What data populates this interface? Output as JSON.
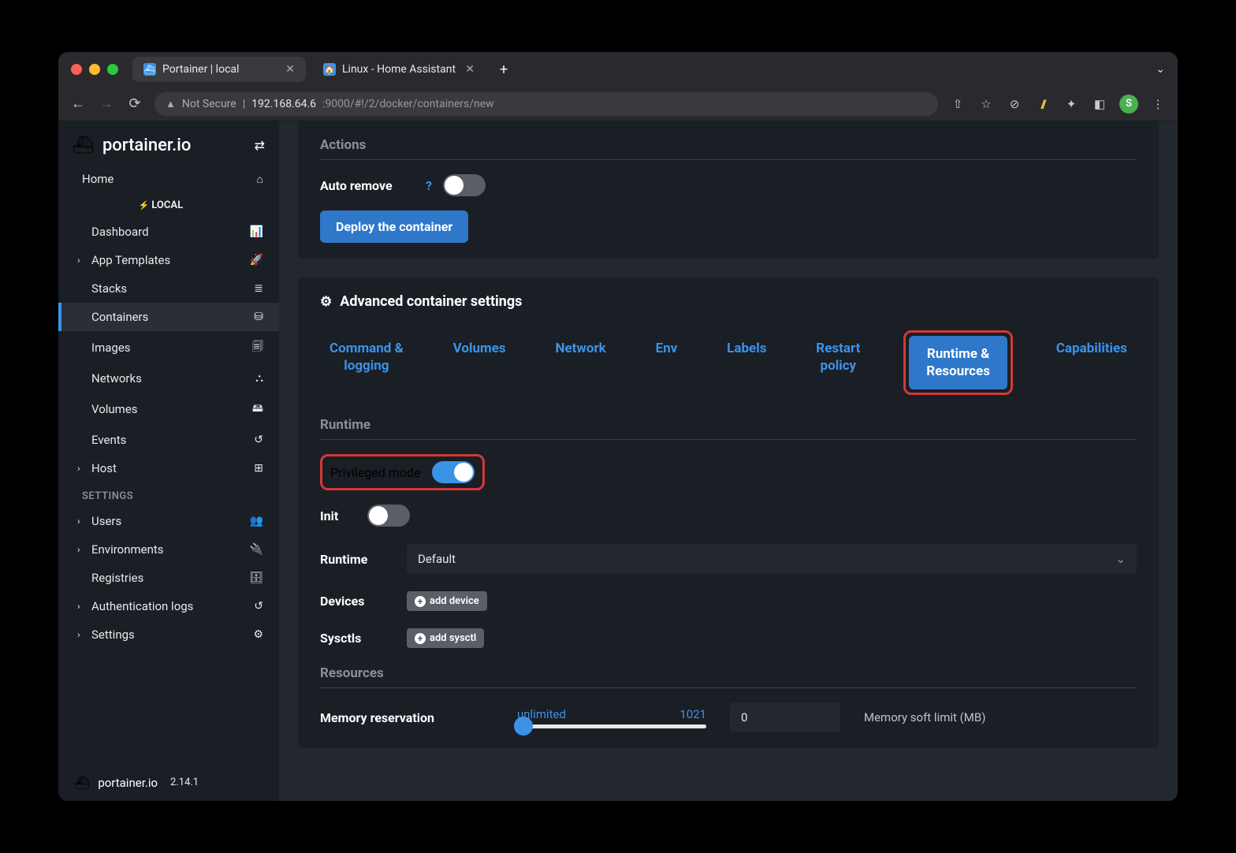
{
  "browser": {
    "tabs": [
      {
        "title": "Portainer | local"
      },
      {
        "title": "Linux - Home Assistant"
      }
    ],
    "url_prefix": "Not Secure",
    "url_host": "192.168.64.6",
    "url_path": ":9000/#!/2/docker/containers/new",
    "avatar_letter": "S"
  },
  "sidebar": {
    "brand": "portainer.io",
    "local_label": "LOCAL",
    "items": [
      {
        "label": "Home",
        "icon": "⌂"
      },
      {
        "label": "Dashboard",
        "icon": "📊"
      },
      {
        "label": "App Templates",
        "icon": "🚀",
        "expandable": true
      },
      {
        "label": "Stacks",
        "icon": "≣"
      },
      {
        "label": "Containers",
        "icon": "⛁",
        "active": true
      },
      {
        "label": "Images",
        "icon": "🗐"
      },
      {
        "label": "Networks",
        "icon": "⛬"
      },
      {
        "label": "Volumes",
        "icon": "🖴"
      },
      {
        "label": "Events",
        "icon": "↺"
      },
      {
        "label": "Host",
        "icon": "⊞",
        "expandable": true
      }
    ],
    "settings_label": "SETTINGS",
    "settings": [
      {
        "label": "Users",
        "icon": "👥",
        "expandable": true
      },
      {
        "label": "Environments",
        "icon": "🔌",
        "expandable": true
      },
      {
        "label": "Registries",
        "icon": "🗄"
      },
      {
        "label": "Authentication logs",
        "icon": "↺",
        "expandable": true
      },
      {
        "label": "Settings",
        "icon": "⚙",
        "expandable": true
      }
    ],
    "footer_brand": "portainer.io",
    "version": "2.14.1"
  },
  "actions": {
    "title": "Actions",
    "auto_remove_label": "Auto remove",
    "deploy_label": "Deploy the container"
  },
  "advanced": {
    "title": "Advanced container settings",
    "tabs": [
      "Command & logging",
      "Volumes",
      "Network",
      "Env",
      "Labels",
      "Restart policy",
      "Runtime & Resources",
      "Capabilities"
    ],
    "runtime_section": "Runtime",
    "privileged_label": "Privileged mode",
    "init_label": "Init",
    "runtime_label": "Runtime",
    "runtime_value": "Default",
    "devices_label": "Devices",
    "add_device": "add device",
    "sysctls_label": "Sysctls",
    "add_sysctl": "add sysctl",
    "resources_section": "Resources",
    "mem_reservation_label": "Memory reservation",
    "slider_min": "unlimited",
    "slider_max": "1021",
    "mem_value": "0",
    "mem_desc": "Memory soft limit (MB)"
  }
}
